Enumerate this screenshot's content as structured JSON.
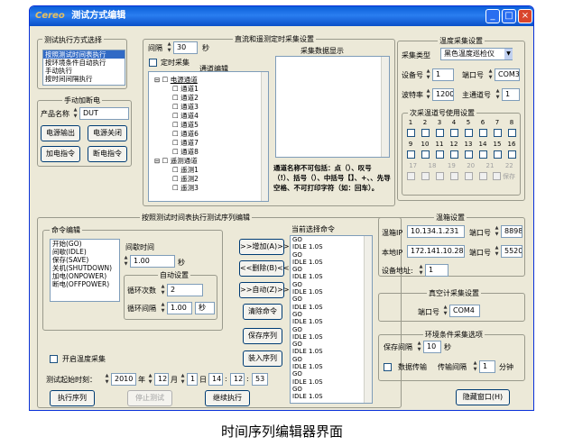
{
  "window": {
    "title": "测试方式编辑",
    "logo": "Cereo",
    "min": "_",
    "max": "□",
    "close": "×"
  },
  "mode": {
    "group": "测试执行方式选择",
    "items": [
      "按照测试时间表执行",
      "按环境条件自动执行",
      "手动执行",
      "按时间间隔执行"
    ]
  },
  "manual": {
    "group": "手动加断电",
    "product_label": "产品名称",
    "product_value": "DUT",
    "btn_power_out": "电源输出",
    "btn_power_off": "电源关闭",
    "btn_power_cmd": "加电指令",
    "btn_cut_cmd": "断电指令"
  },
  "realtime": {
    "group": "直流和遥测定时采集设置",
    "interval_label": "间隔",
    "interval_value": "30",
    "interval_unit": "秒",
    "timed_label": "定时采集",
    "channel_label": "通道编辑",
    "display_label": "采集数据显示",
    "tree_top": "电源通道",
    "tree_ch": [
      "通道1",
      "通道2",
      "通道3",
      "通道4",
      "通道5",
      "通道6",
      "通道7",
      "通道8"
    ],
    "tree_tm": "遥测通道",
    "tree_tm_ch": [
      "遥测1",
      "遥测2",
      "遥测3"
    ],
    "warning": "通道名称不可包括：点（）、叹号（!）、括号（）、中括号【】、+、、先导空格、不可打印字符（如：回车）。"
  },
  "temp": {
    "group": "温度采集设置",
    "type_label": "采集类型",
    "type_value": "黑色温度巡检仪",
    "dev_label": "设备号",
    "dev_value": "1",
    "port_label": "端口号",
    "port_value": "COM3",
    "baud_label": "波特率",
    "baud_value": "1200",
    "addr_label": "主通道号",
    "addr_value": "1",
    "ch_group": "次采温道号使用设置",
    "nums1": [
      "1",
      "2",
      "3",
      "4",
      "5",
      "6",
      "7",
      "8"
    ],
    "nums2": [
      "9",
      "10",
      "11",
      "12",
      "13",
      "14",
      "15",
      "16"
    ],
    "nums3": [
      "17",
      "18",
      "19",
      "20",
      "21",
      "22"
    ],
    "save": "保存"
  },
  "seq": {
    "title": "按照测试时间表执行测试序列编辑",
    "cmd_group": "命令编辑",
    "cmd_list": [
      "开始(GO)",
      "间歇(IDLE)",
      "保存(SAVE)",
      "关机(SHUTDOWN)",
      "加电(ONPOWER)",
      "断电(OFFPOWER)"
    ],
    "interval_label": "间歇时间",
    "interval_value": "1.00",
    "interval_unit": "秒",
    "auto_group": "自动设置",
    "loop_label": "循环次数",
    "loop_value": "2",
    "loop_int_label": "循环间隔",
    "loop_int_value": "1.00",
    "loop_unit": "秒",
    "current_label": "当前选择命令",
    "current_list": [
      "GO",
      "IDLE 1.0S",
      "GO",
      "IDLE 1.0S",
      "GO",
      "IDLE 1.0S",
      "GO",
      "IDLE 1.0S",
      "GO",
      "IDLE 1.0S",
      "GO",
      "IDLE 1.0S",
      "GO",
      "IDLE 1.0S",
      "GO",
      "IDLE 1.0S",
      "GO",
      "IDLE 1.0S",
      "GO",
      "IDLE 1.0S",
      "GO",
      "IDLE 1.0S"
    ],
    "btn_add": ">>增加(A)>>",
    "btn_del": "<<删除(B)<<",
    "btn_auto": ">>自动(Z)>>",
    "btn_clear": "清除命令",
    "btn_save": "保存序列",
    "btn_load": "装入序列",
    "temp_collect": "开启温度采集",
    "start_label": "测试起始时刻：",
    "year": "2010",
    "year_u": "年",
    "month": "12",
    "month_u": "月",
    "day": "1",
    "day_u": "日",
    "hh": "14",
    "mm": "12",
    "ss": "53",
    "sep": ":",
    "btn_run": "执行序列",
    "btn_stop": "停止测试",
    "btn_continue": "继续执行"
  },
  "probe": {
    "group": "温箱设置",
    "ip_label": "温箱IP",
    "ip_value": "10.134.1.231",
    "port_label": "端口号",
    "port_value": "8898",
    "local_label": "本地IP",
    "local_value": "172.141.10.28",
    "lport_label": "端口号",
    "lport_value": "5520",
    "addr_label": "设备地址:",
    "addr_value": "1"
  },
  "vacuum": {
    "group": "真空计采集设置",
    "port_label": "端口号",
    "port_value": "COM4"
  },
  "env": {
    "group": "环境条件采集选项",
    "interval_label": "保存间隔",
    "interval_value": "10",
    "interval_unit": "秒",
    "data_label": "数据传输",
    "trans_label": "传输间隔",
    "trans_value": "1",
    "trans_unit": "分钟"
  },
  "hide_btn": "隐藏窗口(H)",
  "caption": "时间序列编辑器界面"
}
